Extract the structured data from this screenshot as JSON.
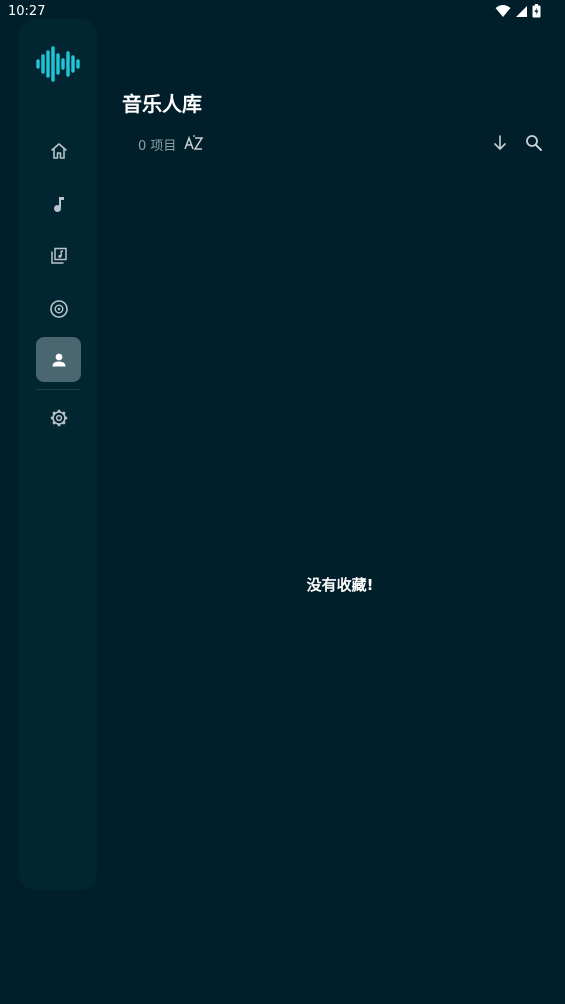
{
  "status_bar": {
    "time": "10:27",
    "icons": [
      "wifi-icon",
      "signal-icon",
      "battery-icon"
    ]
  },
  "sidebar": {
    "logo": "waveform-logo",
    "items": [
      {
        "name": "home",
        "icon": "home-icon",
        "active": false
      },
      {
        "name": "songs",
        "icon": "music-note-icon",
        "active": false
      },
      {
        "name": "playlists",
        "icon": "playlist-icon",
        "active": false
      },
      {
        "name": "albums",
        "icon": "album-disc-icon",
        "active": false
      },
      {
        "name": "artists",
        "icon": "person-icon",
        "active": true
      },
      {
        "name": "settings",
        "icon": "gear-icon",
        "active": false
      }
    ]
  },
  "header": {
    "title": "音乐人库",
    "item_count": "0 项目",
    "sort_icon": "sort-az-icon",
    "actions": [
      "sort-direction-icon",
      "search-icon"
    ]
  },
  "main": {
    "empty_message": "没有收藏!"
  },
  "colors": {
    "background": "#011e2b",
    "sidebar": "#022532",
    "active_item": "#4a6670",
    "accent": "#1fc6d8",
    "muted_text": "#8d9ea6"
  }
}
